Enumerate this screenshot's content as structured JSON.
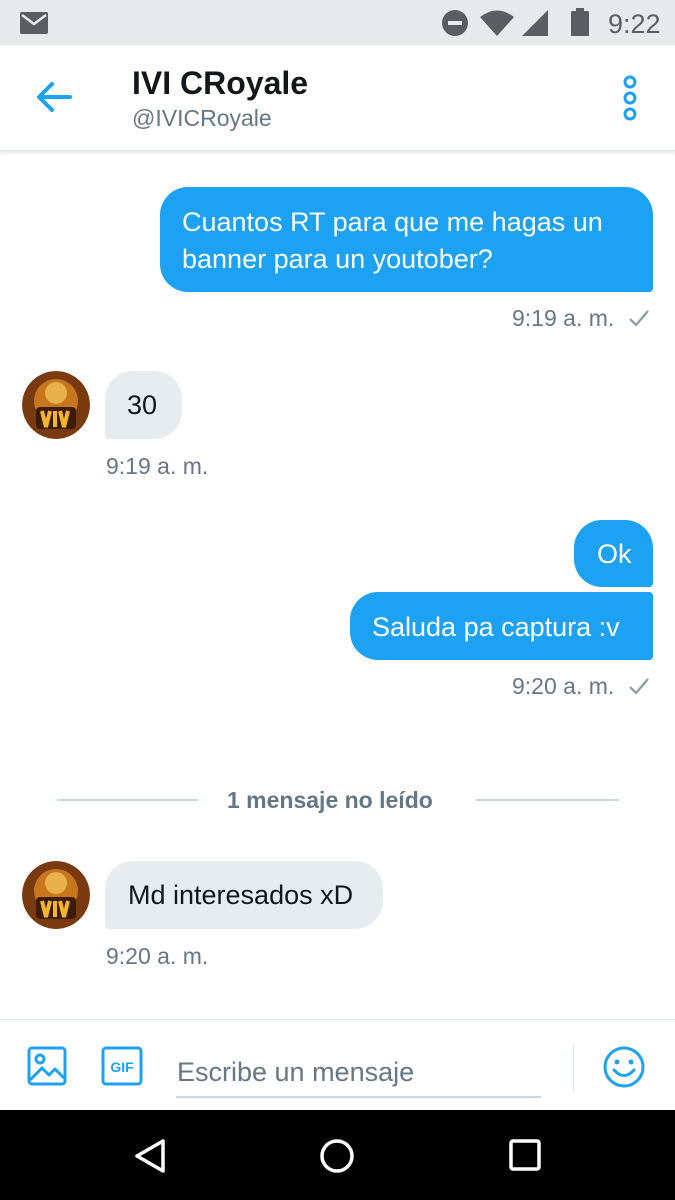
{
  "status_bar": {
    "time": "9:22",
    "icons": [
      "mail-icon",
      "do-not-disturb-icon",
      "wifi-icon",
      "signal-icon",
      "battery-icon"
    ]
  },
  "header": {
    "title": "IVI CRoyale",
    "handle": "@IVICRoyale",
    "icons": [
      "back-arrow-icon",
      "more-vertical-icon"
    ]
  },
  "messages": [
    {
      "direction": "outgoing",
      "text": "Cuantos RT para que me hagas un banner para un youtober?",
      "time": "9:19 a. m.",
      "read_receipt": "check-icon"
    },
    {
      "direction": "incoming",
      "text": "30",
      "time": "9:19 a. m."
    },
    {
      "direction": "outgoing",
      "text": "Ok"
    },
    {
      "direction": "outgoing",
      "text": "Saluda pa captura  :v",
      "time": "9:20 a. m.",
      "read_receipt": "check-icon"
    },
    {
      "direction": "incoming",
      "text": "Md interesados xD",
      "time": "9:20 a. m."
    }
  ],
  "unread_divider": "1 mensaje no leído",
  "composer": {
    "placeholder": "Escribe un mensaje",
    "gif_label": "GIF",
    "icons": [
      "image-icon",
      "gif-icon",
      "emoji-icon"
    ]
  },
  "nav_bar": {
    "icons": [
      "nav-back-icon",
      "nav-home-icon",
      "nav-recents-icon"
    ]
  },
  "colors": {
    "accent": "#1da1f2",
    "incoming_bubble": "#e6ecf0",
    "secondary_text": "#657786",
    "status_bar_bg": "#e8e9ea"
  }
}
